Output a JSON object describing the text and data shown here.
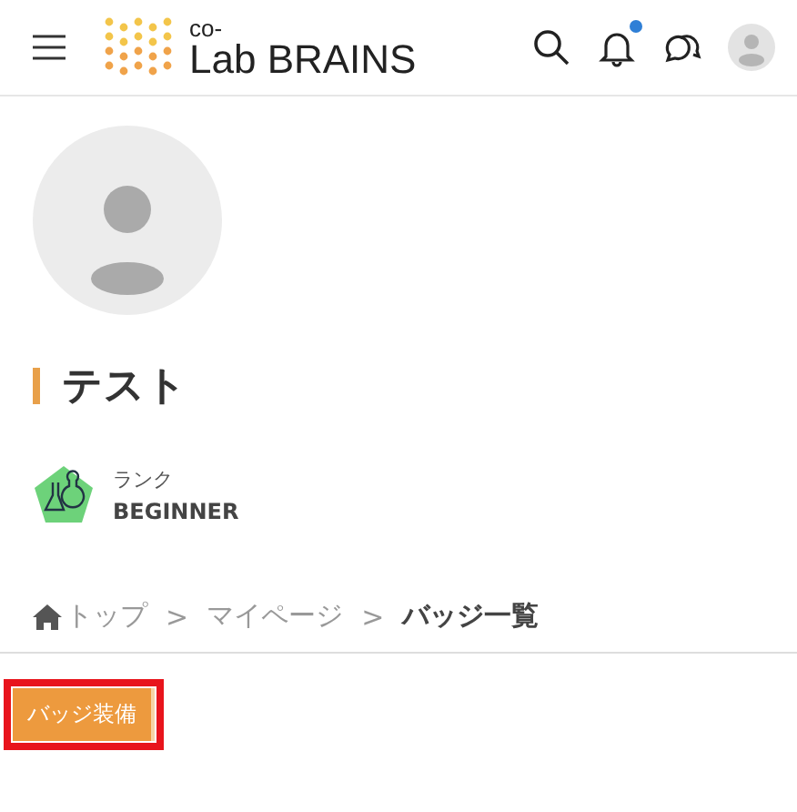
{
  "header": {
    "logo_top": "co-",
    "logo_main": "Lab BRAINS",
    "notifications_unread": true
  },
  "profile": {
    "name": "テスト",
    "rank_label": "ランク",
    "rank": "BEGINNER"
  },
  "breadcrumb": [
    {
      "label": "トップ",
      "kind": "home",
      "current": false
    },
    {
      "label": "マイページ",
      "kind": "page",
      "current": false
    },
    {
      "label": "バッジ一覧",
      "kind": "page",
      "current": true
    }
  ],
  "separator": ">",
  "button": {
    "label": "バッジ装備",
    "highlighted": true
  }
}
